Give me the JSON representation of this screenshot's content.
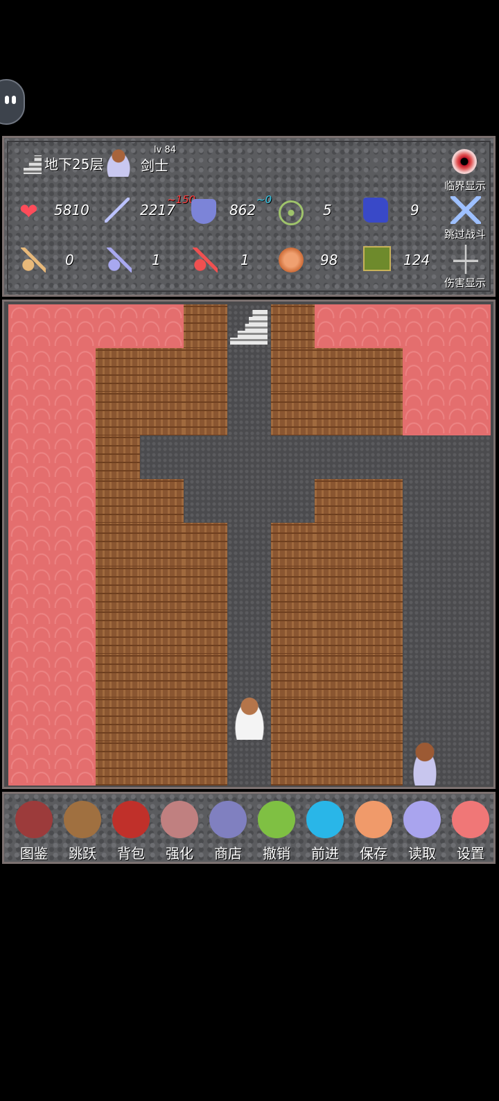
{
  "status": {
    "floor": "地下25层",
    "level": "lv 84",
    "class": "剑士",
    "hp": "5810",
    "atk": "2217",
    "atk_bonus": "~150",
    "def": "862",
    "def_bonus": "~0",
    "mdef": "5",
    "speed": "9",
    "yellow_keys": "0",
    "blue_keys": "1",
    "red_keys": "1",
    "gold": "98",
    "exp": "124",
    "btn_critical": "临界显示",
    "btn_skip_battle": "跳过战斗",
    "btn_damage": "伤害显示"
  },
  "toolbar": {
    "items": [
      {
        "label": "图鉴",
        "icon": "monster-book-icon",
        "color": "#9c3b3b"
      },
      {
        "label": "跳跃",
        "icon": "jump-staff-icon",
        "color": "#a07040"
      },
      {
        "label": "背包",
        "icon": "bag-icon",
        "color": "#c0302a"
      },
      {
        "label": "强化",
        "icon": "fairy-icon",
        "color": "#c08080"
      },
      {
        "label": "商店",
        "icon": "shop-icon",
        "color": "#8080c0"
      },
      {
        "label": "撤销",
        "icon": "undo-icon",
        "color": "#7fc043"
      },
      {
        "label": "前进",
        "icon": "redo-icon",
        "color": "#29b6e8"
      },
      {
        "label": "保存",
        "icon": "save-icon",
        "color": "#f09a6a"
      },
      {
        "label": "读取",
        "icon": "load-icon",
        "color": "#a9a4ee"
      },
      {
        "label": "设置",
        "icon": "settings-icon",
        "color": "#f07777"
      }
    ]
  },
  "colors": {
    "lava": "#e46e6e",
    "brick": "#8a5631",
    "stone": "#4b4b4e"
  }
}
